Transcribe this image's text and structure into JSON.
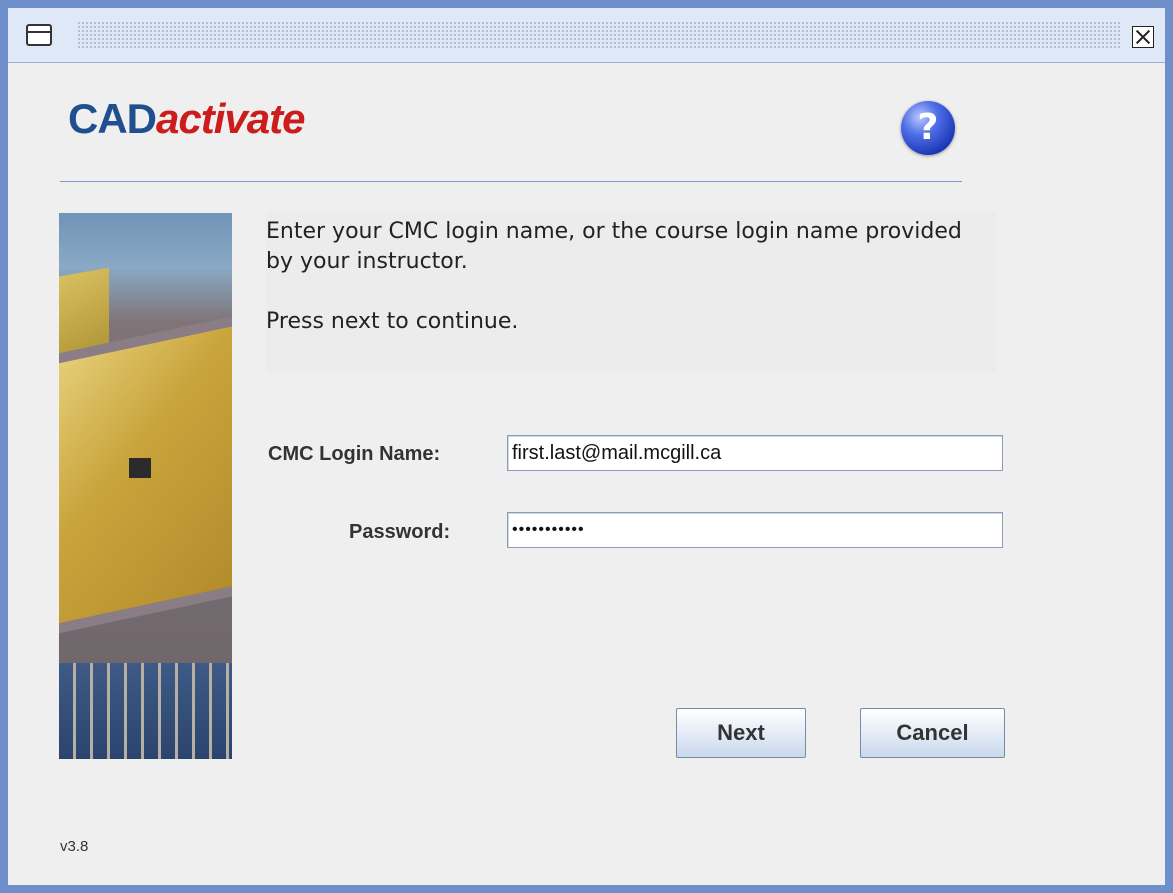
{
  "window": {
    "title": "",
    "window_icon": "window-icon",
    "close_icon": "close-icon"
  },
  "header": {
    "logo_part1": "CAD",
    "logo_part2": "activate",
    "help_icon": "help-icon",
    "help_symbol": "?"
  },
  "instructions": {
    "line1": "Enter your CMC login name, or the course login name provided by your instructor.",
    "line2": "Press next to continue."
  },
  "form": {
    "login_label": "CMC Login Name:",
    "login_value": "first.last@mail.mcgill.ca",
    "password_label": "Password:",
    "password_value": "•••••••••••"
  },
  "buttons": {
    "next": "Next",
    "cancel": "Cancel"
  },
  "footer": {
    "version": "v3.8"
  },
  "colors": {
    "logo_blue": "#1f4f8f",
    "logo_red": "#cc1c1c",
    "window_border": "#6f8fcb"
  }
}
